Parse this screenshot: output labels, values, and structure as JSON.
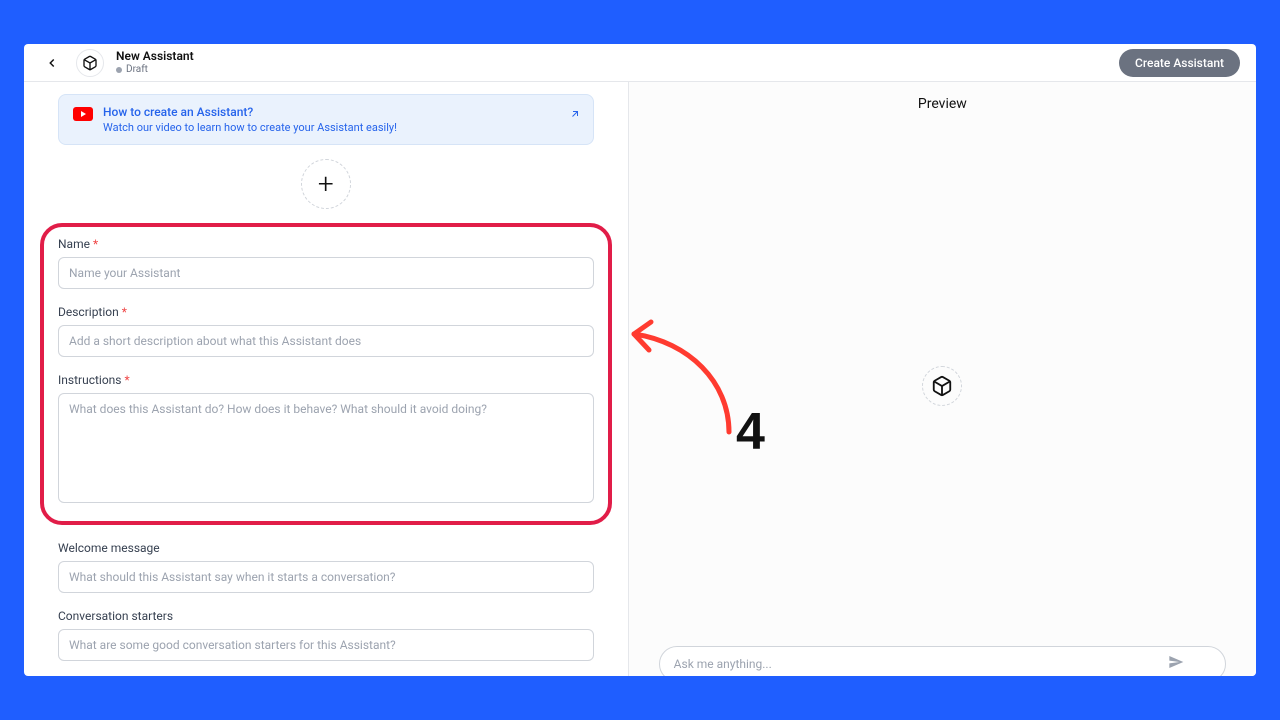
{
  "header": {
    "title": "New Assistant",
    "status": "Draft",
    "create_button": "Create Assistant"
  },
  "banner": {
    "title": "How to create an Assistant?",
    "subtitle": "Watch our video to learn how to create your Assistant easily!"
  },
  "form": {
    "name": {
      "label": "Name",
      "placeholder": "Name your Assistant"
    },
    "description": {
      "label": "Description",
      "placeholder": "Add a short description about what this Assistant does"
    },
    "instructions": {
      "label": "Instructions",
      "placeholder": "What does this Assistant do? How does it behave? What should it avoid doing?"
    },
    "welcome": {
      "label": "Welcome message",
      "placeholder": "What should this Assistant say when it starts a conversation?"
    },
    "starters": {
      "label": "Conversation starters",
      "placeholder": "What are some good conversation starters for this Assistant?"
    }
  },
  "preview": {
    "title": "Preview",
    "chat_placeholder": "Ask me anything..."
  },
  "annotation": {
    "number": "4"
  }
}
